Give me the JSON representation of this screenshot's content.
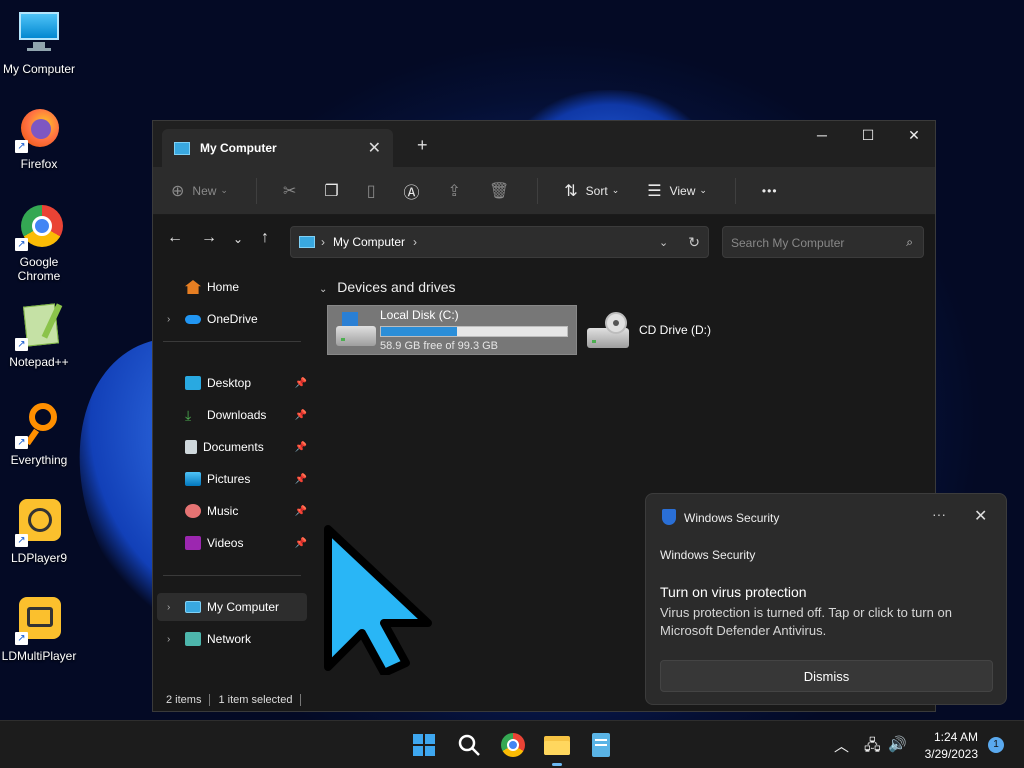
{
  "desktop": {
    "icons": [
      {
        "label": "My Computer"
      },
      {
        "label": "Firefox"
      },
      {
        "label": "Google Chrome"
      },
      {
        "label": "Notepad++"
      },
      {
        "label": "Everything"
      },
      {
        "label": "LDPlayer9"
      },
      {
        "label": "LDMultiPlayer"
      }
    ]
  },
  "explorer": {
    "tab_title": "My Computer",
    "new_tab": "+",
    "toolbar": {
      "new_label": "New",
      "sort_label": "Sort",
      "view_label": "View",
      "more_label": "•••"
    },
    "address": {
      "path": "My Computer"
    },
    "search": {
      "placeholder": "Search My Computer"
    },
    "sidebar": {
      "items": [
        {
          "label": "Home"
        },
        {
          "label": "OneDrive"
        },
        {
          "label": "Desktop"
        },
        {
          "label": "Downloads"
        },
        {
          "label": "Documents"
        },
        {
          "label": "Pictures"
        },
        {
          "label": "Music"
        },
        {
          "label": "Videos"
        },
        {
          "label": "My Computer"
        },
        {
          "label": "Network"
        }
      ]
    },
    "content": {
      "section": "Devices and drives",
      "drives": [
        {
          "name": "Local Disk (C:)",
          "free_text": "58.9 GB free of 99.3 GB",
          "used_fraction": 0.407
        },
        {
          "name": "CD Drive (D:)"
        }
      ]
    },
    "status": {
      "items": "2 items",
      "selected": "1 item selected"
    }
  },
  "notification": {
    "app": "Windows Security",
    "subtitle": "Windows Security",
    "title": "Turn on virus protection",
    "body": "Virus protection is turned off. Tap or click to turn on Microsoft Defender Antivirus.",
    "dismiss": "Dismiss",
    "more": "···"
  },
  "taskbar": {
    "time": "1:24 AM",
    "date": "3/29/2023",
    "badge": "1"
  },
  "colors": {
    "accent": "#2b8ed8",
    "cursor": "#29b6f6"
  }
}
